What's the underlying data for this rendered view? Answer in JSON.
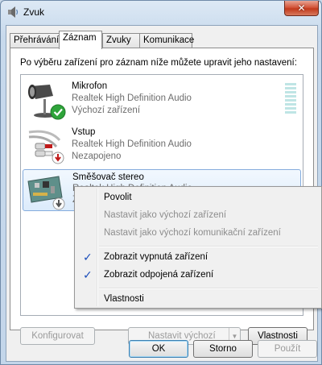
{
  "window": {
    "title": "Zvuk",
    "close_glyph": "✕"
  },
  "tabs": [
    {
      "label": "Přehrávání"
    },
    {
      "label": "Záznam"
    },
    {
      "label": "Zvuky"
    },
    {
      "label": "Komunikace"
    }
  ],
  "panel": {
    "instruction": "Po výběru zařízení pro záznam níže můžete upravit jeho nastavení:"
  },
  "devices": [
    {
      "name": "Mikrofon",
      "driver": "Realtek High Definition Audio",
      "status": "Výchozí zařízení",
      "icon": "microphone-icon",
      "badge": "default-check-badge-icon",
      "level_meter": "level-meter"
    },
    {
      "name": "Vstup",
      "driver": "Realtek High Definition Audio",
      "status": "Nezapojeno",
      "icon": "audio-cable-icon",
      "badge": "unplugged-badge-icon"
    },
    {
      "name": "Směšovač stereo",
      "driver": "Realtek High Definition Audio",
      "status": "Z",
      "icon": "sound-card-icon",
      "badge": "disabled-badge-icon"
    }
  ],
  "buttons": {
    "configure": "Konfigurovat",
    "set_default": "Nastavit výchozí",
    "properties": "Vlastnosti",
    "ok": "OK",
    "cancel": "Storno",
    "apply": "Použít"
  },
  "context_menu": {
    "items": [
      {
        "label": "Povolit",
        "enabled": true,
        "checked": false
      },
      {
        "label": "Nastavit jako výchozí zařízení",
        "enabled": false,
        "checked": false
      },
      {
        "label": "Nastavit jako výchozí komunikační zařízení",
        "enabled": false,
        "checked": false
      },
      {
        "label": "Zobrazit vypnutá zařízení",
        "enabled": true,
        "checked": true
      },
      {
        "label": "Zobrazit odpojená zařízení",
        "enabled": true,
        "checked": true
      },
      {
        "label": "Vlastnosti",
        "enabled": true,
        "checked": false
      }
    ],
    "check_glyph": "✓"
  },
  "colors": {
    "accent_check": "#1a4dba",
    "selection_border": "#84acdd",
    "close_button": "#c23a1c"
  }
}
